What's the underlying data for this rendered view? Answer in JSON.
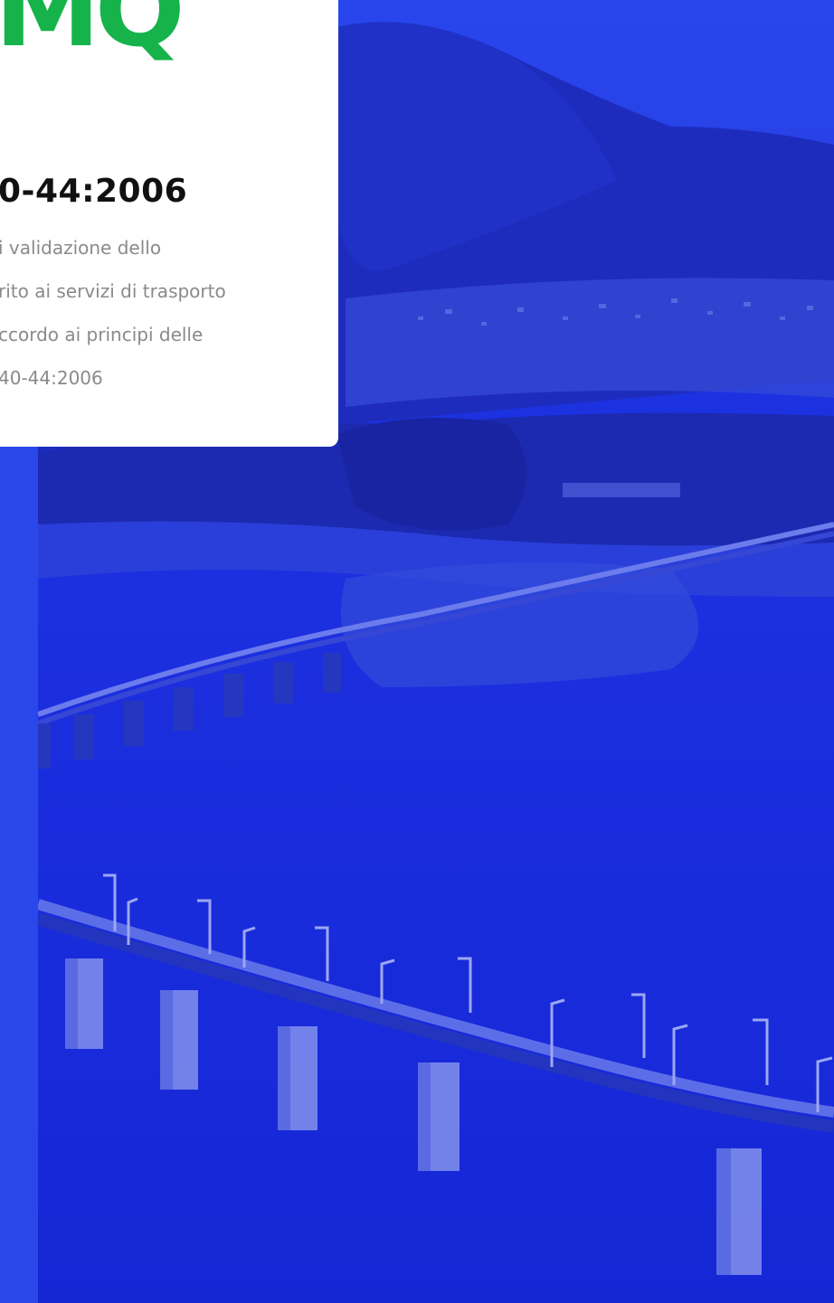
{
  "logo": {
    "text": "MQ",
    "color": "#16b34a"
  },
  "card": {
    "title": "0-44:2006",
    "description_lines": [
      "i validazione dello",
      "rito ai servizi di trasporto",
      "ccordo ai principi delle",
      "40-44:2006"
    ]
  },
  "hero": {
    "image_subject": "bridge-over-lake-with-mountains",
    "overlay_color": "#1f2ee0"
  }
}
